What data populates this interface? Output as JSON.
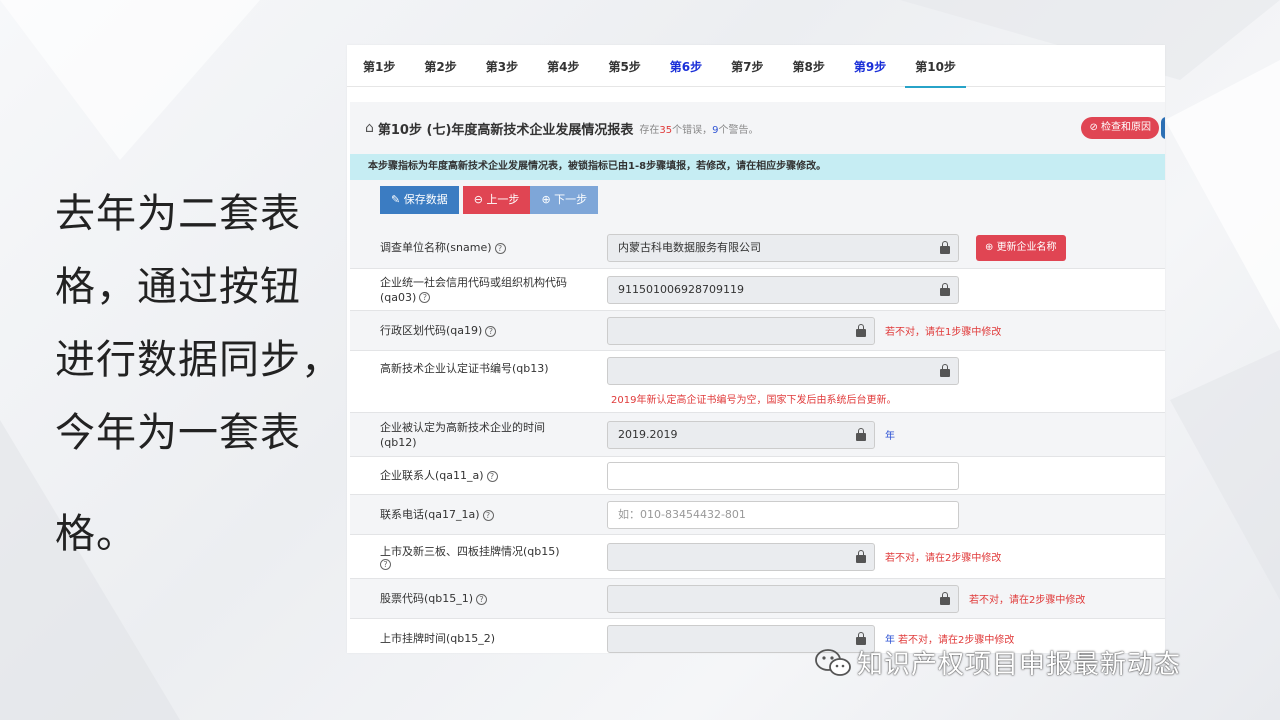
{
  "slide": {
    "left_text_lines": [
      "去年为二套表",
      "格，通过按钮",
      "进行数据同步，",
      "今年为一套表",
      "格。"
    ]
  },
  "tabs": [
    {
      "label": "第1步",
      "highlight": false
    },
    {
      "label": "第2步",
      "highlight": false
    },
    {
      "label": "第3步",
      "highlight": false
    },
    {
      "label": "第4步",
      "highlight": false
    },
    {
      "label": "第5步",
      "highlight": false
    },
    {
      "label": "第6步",
      "highlight": true
    },
    {
      "label": "第7步",
      "highlight": false
    },
    {
      "label": "第8步",
      "highlight": false
    },
    {
      "label": "第9步",
      "highlight": true
    },
    {
      "label": "第10步",
      "highlight": false,
      "active": true
    }
  ],
  "header": {
    "title": "第10步 (七)年度高新技术企业发展情况报表",
    "status_prefix": "存在",
    "error_count": "35",
    "status_mid": "个错误，",
    "warning_count": "9",
    "status_suffix": "个警告。",
    "check_button": "检查和原因"
  },
  "notice": "本步骤指标为年度高新技术企业发展情况表，被锁指标已由1-8步骤填报，若修改，请在相应步骤修改。",
  "buttons": {
    "save": "保存数据",
    "prev": "上一步",
    "next": "下一步",
    "update_name": "更新企业名称"
  },
  "fields": [
    {
      "label": "调查单位名称(sname)",
      "value": "内蒙古科电数据服务有限公司"
    },
    {
      "label": "企业统一社会信用代码或组织机构代码",
      "label2": "(qa03)",
      "value": "911501006928709119"
    },
    {
      "label": "行政区划代码(qa19)",
      "value": "",
      "hint": "若不对，请在1步骤中修改"
    },
    {
      "label": "高新技术企业认定证书编号(qb13)",
      "value": "",
      "note": "2019年新认定高企证书编号为空，国家下发后由系统后台更新。"
    },
    {
      "label": "企业被认定为高新技术企业的时间",
      "label2": "(qb12)",
      "value": "2019.2019",
      "unit": "年"
    },
    {
      "label": "企业联系人(qa11_a)",
      "value": ""
    },
    {
      "label": "联系电话(qa17_1a)",
      "placeholder": "如：010-83454432-801"
    },
    {
      "label": "上市及新三板、四板挂牌情况(qb15)",
      "value": "",
      "hint": "若不对，请在2步骤中修改"
    },
    {
      "label": "股票代码(qb15_1)",
      "value": "",
      "hint": "若不对，请在2步骤中修改"
    },
    {
      "label": "上市挂牌时间(qb15_2)",
      "value": "",
      "unit": "年",
      "hint": "若不对，请在2步骤中修改"
    }
  ],
  "watermark": "知识产权项目申报最新动态",
  "colors": {
    "accent_blue": "#3b7cc2",
    "danger_red": "#e04553",
    "tab_highlight": "#1a2fd8",
    "notice_bg": "#c6edf3"
  }
}
